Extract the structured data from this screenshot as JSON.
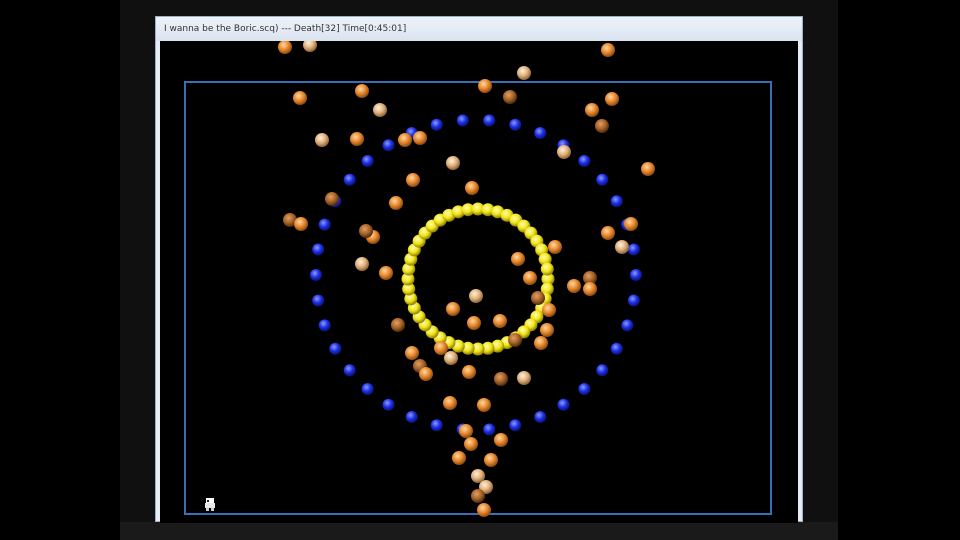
{
  "window": {
    "title": "I wanna be the Boric.scq) --- Death[32] Time[0:45:01]"
  },
  "game": {
    "player_sprite": "kid-player-sprite",
    "bullet_colors": {
      "orange": "#e8872a",
      "tan": "#e0b07a",
      "brown": "#a8642a",
      "yellow": "#f2e41a",
      "blue": "#1c2ee6"
    },
    "arena_border_color": "#3a6fb8"
  }
}
